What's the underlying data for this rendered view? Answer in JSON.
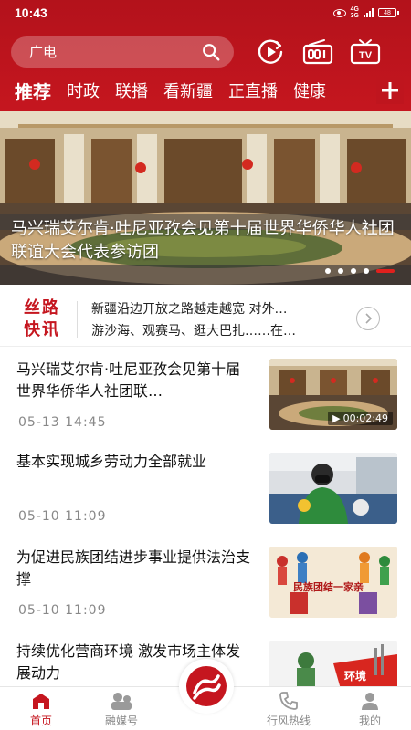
{
  "status_bar": {
    "time": "10:43",
    "network": [
      "4G",
      "3G"
    ],
    "battery": "48"
  },
  "search": {
    "placeholder": "广电"
  },
  "top_icons": [
    "play-circle-icon",
    "radio-icon",
    "tv-icon"
  ],
  "tabs": [
    {
      "label": "推荐",
      "active": true
    },
    {
      "label": "时政"
    },
    {
      "label": "联播"
    },
    {
      "label": "看新疆"
    },
    {
      "label": "正直播"
    },
    {
      "label": "健康"
    }
  ],
  "hero": {
    "caption": "马兴瑞艾尔肯·吐尼亚孜会见第十届世界华侨华人社团联谊大会代表参访团",
    "slide_count": 5,
    "active_slide": 5
  },
  "silk_road": {
    "badge_line1": "丝路",
    "badge_line2": "快讯",
    "line1": "新疆沿边开放之路越走越宽 对外…",
    "line2": "游沙海、观赛马、逛大巴扎……在…"
  },
  "news": [
    {
      "title": "马兴瑞艾尔肯·吐尼亚孜会见第十届世界华侨华人社团联…",
      "time": "05-13 14:45",
      "duration": "00:02:49"
    },
    {
      "title": "基本实现城乡劳动力全部就业",
      "time": "05-10 11:09"
    },
    {
      "title": "为促进民族团结进步事业提供法治支撑",
      "time": "05-10 11:09",
      "thumb_text": "民族团结一家亲"
    },
    {
      "title": "持续优化营商环境 激发市场主体发展动力",
      "thumb_text": "环境"
    }
  ],
  "bottom_nav": [
    {
      "label": "首页",
      "active": true
    },
    {
      "label": "融媒号"
    },
    {
      "label": "行风热线"
    },
    {
      "label": "我的"
    }
  ],
  "colors": {
    "brand_red": "#c5161f",
    "header_red": "#b3121b"
  }
}
